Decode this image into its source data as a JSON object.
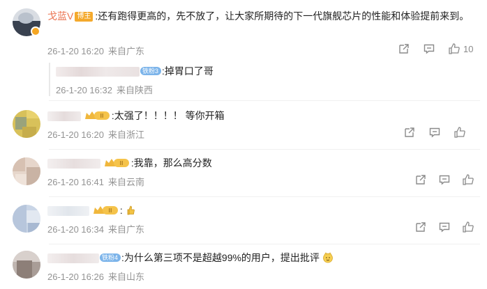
{
  "colors": {
    "name": "#eb7350",
    "meta": "#939393",
    "icon": "#8a8a8a",
    "badge_blogger": "#f4a92c",
    "badge_fan": "#7cb4ea"
  },
  "comments": [
    {
      "name": "戈蓝V",
      "badge": "博主",
      "text": ":还有跑得更高的，先不放了，让大家所期待的下一代旗舰芯片的性能和体验提前来到。",
      "time": "26-1-20 16:20",
      "location": "来自广东",
      "likes": "10",
      "icons": [
        "share-icon",
        "comment-icon",
        "like-icon"
      ]
    },
    {
      "badge": "铁粉3",
      "text": ":掉胃口了哥",
      "time": "26-1-20 16:32",
      "location": "来自陕西"
    },
    {
      "badge": "II",
      "text": ":太强了！！！！ 等你开箱",
      "time": "26-1-20 16:20",
      "location": "来自浙江"
    },
    {
      "badge": "II",
      "text": ":我靠，那么高分数",
      "time": "26-1-20 16:41",
      "location": "来自云南"
    },
    {
      "badge": "II",
      "text": ":",
      "time": "26-1-20 16:34",
      "location": "来自广东"
    },
    {
      "badge": "铁粉4",
      "text": ":为什么第三项不是超越99%的用户，提出批评",
      "time": "26-1-20 16:26",
      "location": "来自山东"
    }
  ]
}
